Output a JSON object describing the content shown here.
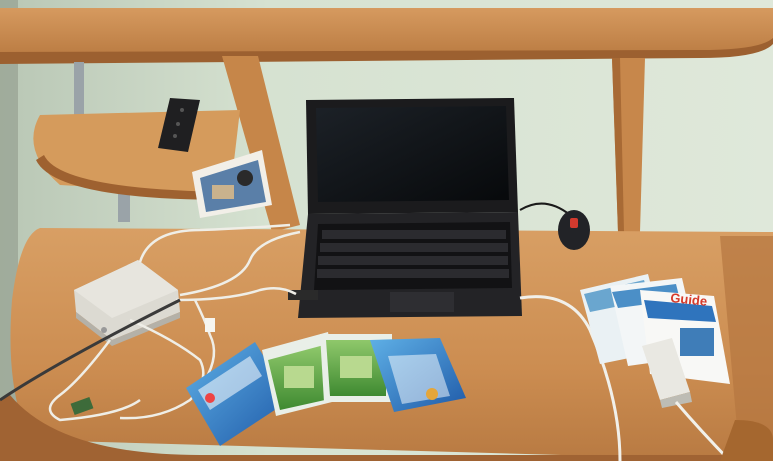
{
  "scene": {
    "description_visible_text": {
      "leaflet_front_label": "Guide"
    },
    "colors": {
      "wall": "#d7e3d2",
      "wood": "#c98a4e",
      "wood_dark": "#a76534",
      "laptop": "#1b1b1d",
      "screen": "#0d0f12",
      "cable": "#f0efe8",
      "device": "#dcdad2",
      "cd_blue": "#2f6fbf",
      "cd_green": "#4f9a3a"
    }
  }
}
